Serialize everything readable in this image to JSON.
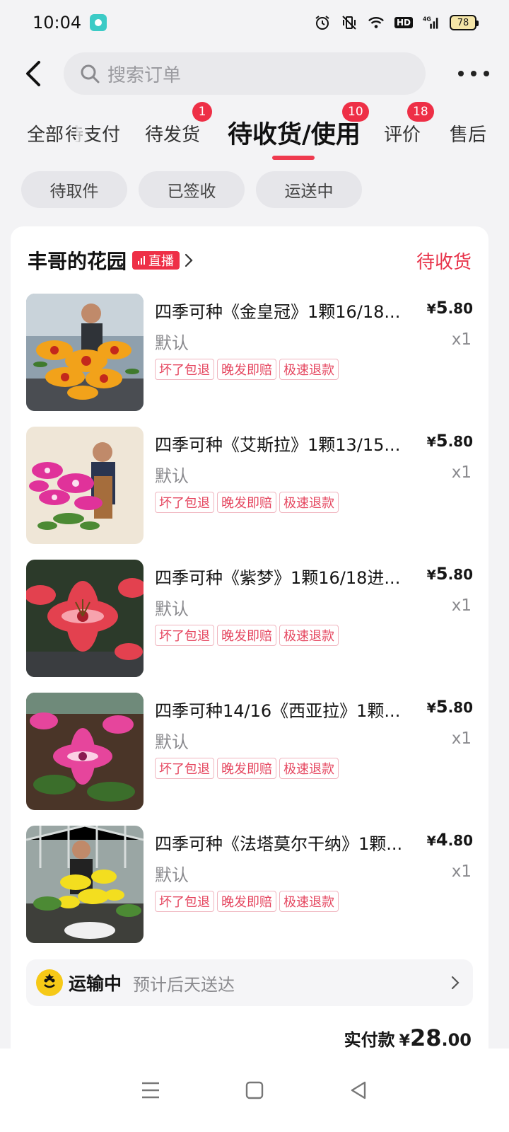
{
  "status_bar": {
    "time": "10:04",
    "network": "4G",
    "hd": "HD",
    "battery": "78"
  },
  "header": {
    "search_placeholder": "搜索订单"
  },
  "tabs": [
    {
      "label": "全部"
    },
    {
      "label": "待支付"
    },
    {
      "label": "待发货",
      "badge": "1"
    },
    {
      "label": "待收货/使用",
      "badge": "10",
      "active": true
    },
    {
      "label": "评价",
      "badge": "18"
    },
    {
      "label": "售后"
    }
  ],
  "chips": [
    "待取件",
    "已签收",
    "运送中"
  ],
  "order": {
    "shop_name": "丰哥的花园",
    "live_label": "直播",
    "status": "待收货",
    "products": [
      {
        "title": "四季可种《金皇冠》1颗16/18...",
        "variant": "默认",
        "price_symbol": "¥",
        "price_int": "5",
        "price_dec": ".80",
        "qty": "x1",
        "tags": [
          "坏了包退",
          "晚发即赔",
          "极速退款"
        ]
      },
      {
        "title": "四季可种《艾斯拉》1颗13/15...",
        "variant": "默认",
        "price_symbol": "¥",
        "price_int": "5",
        "price_dec": ".80",
        "qty": "x1",
        "tags": [
          "坏了包退",
          "晚发即赔",
          "极速退款"
        ]
      },
      {
        "title": "四季可种《紫梦》1颗16/18进...",
        "variant": "默认",
        "price_symbol": "¥",
        "price_int": "5",
        "price_dec": ".80",
        "qty": "x1",
        "tags": [
          "坏了包退",
          "晚发即赔",
          "极速退款"
        ]
      },
      {
        "title": "四季可种14/16《西亚拉》1颗...",
        "variant": "默认",
        "price_symbol": "¥",
        "price_int": "5",
        "price_dec": ".80",
        "qty": "x1",
        "tags": [
          "坏了包退",
          "晚发即赔",
          "极速退款"
        ]
      },
      {
        "title": "四季可种《法塔莫尔干纳》1颗...",
        "variant": "默认",
        "price_symbol": "¥",
        "price_int": "4",
        "price_dec": ".80",
        "qty": "x1",
        "tags": [
          "坏了包退",
          "晚发即赔",
          "极速退款"
        ]
      }
    ],
    "shipping": {
      "status": "运输中",
      "eta": "预计后天送达"
    },
    "total": {
      "label": "实付款",
      "symbol": "¥",
      "int": "28",
      "dec": ".00"
    }
  },
  "colors": {
    "accent_red": "#ee2f46",
    "status_red": "#e8344b",
    "tag_red": "#e5465f",
    "courier_yellow": "#f6c917"
  }
}
